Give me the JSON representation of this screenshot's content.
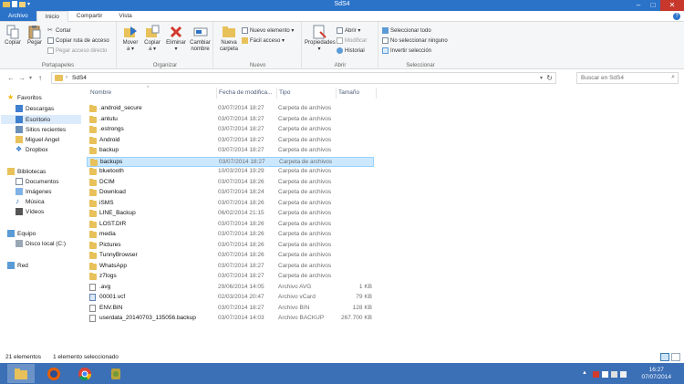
{
  "window": {
    "title": "SdS4"
  },
  "tabs": [
    "Archivo",
    "Inicio",
    "Compartir",
    "Vista"
  ],
  "ribbon": {
    "portapapeles": {
      "label": "Portapapeles",
      "copy": "Copiar",
      "paste": "Pegar",
      "cut": "Cortar",
      "copy_path": "Copiar ruta de acceso",
      "paste_shortcut": "Pegar acceso directo"
    },
    "organizar": {
      "label": "Organizar",
      "move": "Mover",
      "move2": "a ▾",
      "copy": "Copiar",
      "copy2": "a ▾",
      "delete": "Eliminar",
      "delete2": "▾",
      "rename": "Cambiar",
      "rename2": "nombre"
    },
    "nuevo": {
      "label": "Nuevo",
      "new_folder": "Nueva",
      "new_folder2": "carpeta",
      "new_item": "Nuevo elemento ▾",
      "easy_access": "Fácil acceso ▾"
    },
    "abrir": {
      "label": "Abrir",
      "properties": "Propiedades",
      "properties2": "▾",
      "open": "Abrir ▾",
      "edit": "Modificar",
      "history": "Historial"
    },
    "seleccionar": {
      "label": "Seleccionar",
      "select_all": "Seleccionar todo",
      "select_none": "No seleccionar ninguno",
      "invert": "Invertir selección"
    }
  },
  "address": {
    "path": "SdS4",
    "search_placeholder": "Buscar en SdS4"
  },
  "navpane": {
    "favorites": "Favoritos",
    "downloads": "Descargas",
    "desktop": "Escritorio",
    "recent": "Sitios recientes",
    "user": "Miguel Angel",
    "dropbox": "Dropbox",
    "libraries": "Bibliotecas",
    "documents": "Documentos",
    "images": "Imágenes",
    "music": "Música",
    "videos": "Vídeos",
    "computer": "Equipo",
    "disk": "Disco local (C:)",
    "network": "Red"
  },
  "columns": {
    "name": "Nombre",
    "date": "Fecha de modifica...",
    "type": "Tipo",
    "size": "Tamaño"
  },
  "files": [
    {
      "name": ".android_secure",
      "date": "03/07/2014 18:27",
      "type": "Carpeta de archivos",
      "size": "",
      "kind": "folder"
    },
    {
      "name": ".antutu",
      "date": "03/07/2014 18:27",
      "type": "Carpeta de archivos",
      "size": "",
      "kind": "folder"
    },
    {
      "name": ".estrongs",
      "date": "03/07/2014 18:27",
      "type": "Carpeta de archivos",
      "size": "",
      "kind": "folder"
    },
    {
      "name": "Android",
      "date": "03/07/2014 18:27",
      "type": "Carpeta de archivos",
      "size": "",
      "kind": "folder"
    },
    {
      "name": "backup",
      "date": "03/07/2014 18:27",
      "type": "Carpeta de archivos",
      "size": "",
      "kind": "folder"
    },
    {
      "name": "backups",
      "date": "03/07/2014 18:27",
      "type": "Carpeta de archivos",
      "size": "",
      "kind": "folder",
      "selected": true
    },
    {
      "name": "bluetooth",
      "date": "10/03/2014 19:29",
      "type": "Carpeta de archivos",
      "size": "",
      "kind": "folder"
    },
    {
      "name": "DCIM",
      "date": "03/07/2014 18:26",
      "type": "Carpeta de archivos",
      "size": "",
      "kind": "folder"
    },
    {
      "name": "Download",
      "date": "03/07/2014 18:24",
      "type": "Carpeta de archivos",
      "size": "",
      "kind": "folder"
    },
    {
      "name": "iSMS",
      "date": "03/07/2014 18:26",
      "type": "Carpeta de archivos",
      "size": "",
      "kind": "folder"
    },
    {
      "name": "LINE_Backup",
      "date": "06/02/2014 21:15",
      "type": "Carpeta de archivos",
      "size": "",
      "kind": "folder"
    },
    {
      "name": "LOST.DIR",
      "date": "03/07/2014 18:26",
      "type": "Carpeta de archivos",
      "size": "",
      "kind": "folder"
    },
    {
      "name": "media",
      "date": "03/07/2014 18:26",
      "type": "Carpeta de archivos",
      "size": "",
      "kind": "folder"
    },
    {
      "name": "Pictures",
      "date": "03/07/2014 18:26",
      "type": "Carpeta de archivos",
      "size": "",
      "kind": "folder"
    },
    {
      "name": "TunnyBrowser",
      "date": "03/07/2014 18:26",
      "type": "Carpeta de archivos",
      "size": "",
      "kind": "folder"
    },
    {
      "name": "WhatsApp",
      "date": "03/07/2014 18:27",
      "type": "Carpeta de archivos",
      "size": "",
      "kind": "folder"
    },
    {
      "name": "z7logs",
      "date": "03/07/2014 18:27",
      "type": "Carpeta de archivos",
      "size": "",
      "kind": "folder"
    },
    {
      "name": ".avg",
      "date": "29/06/2014 14:05",
      "type": "Archivo AVG",
      "size": "1 KB",
      "kind": "file"
    },
    {
      "name": "00001.vcf",
      "date": "02/03/2014 20:47",
      "type": "Archivo vCard",
      "size": "79 KB",
      "kind": "vcard"
    },
    {
      "name": "ENV.BIN",
      "date": "03/07/2014 18:27",
      "type": "Archivo BIN",
      "size": "128 KB",
      "kind": "file"
    },
    {
      "name": "userdata_20140703_135056.backup",
      "date": "03/07/2014 14:03",
      "type": "Archivo BACKUP",
      "size": "267.700 KB",
      "kind": "file"
    }
  ],
  "status": {
    "count": "21 elementos",
    "selected": "1 elemento seleccionado"
  },
  "taskbar": {
    "time": "16:27",
    "date": "07/07/2014"
  },
  "colors": {
    "accent": "#2b73c9",
    "taskbar": "#3b6fb6",
    "folder": "#e8c15a",
    "selection": "#cce8ff"
  }
}
